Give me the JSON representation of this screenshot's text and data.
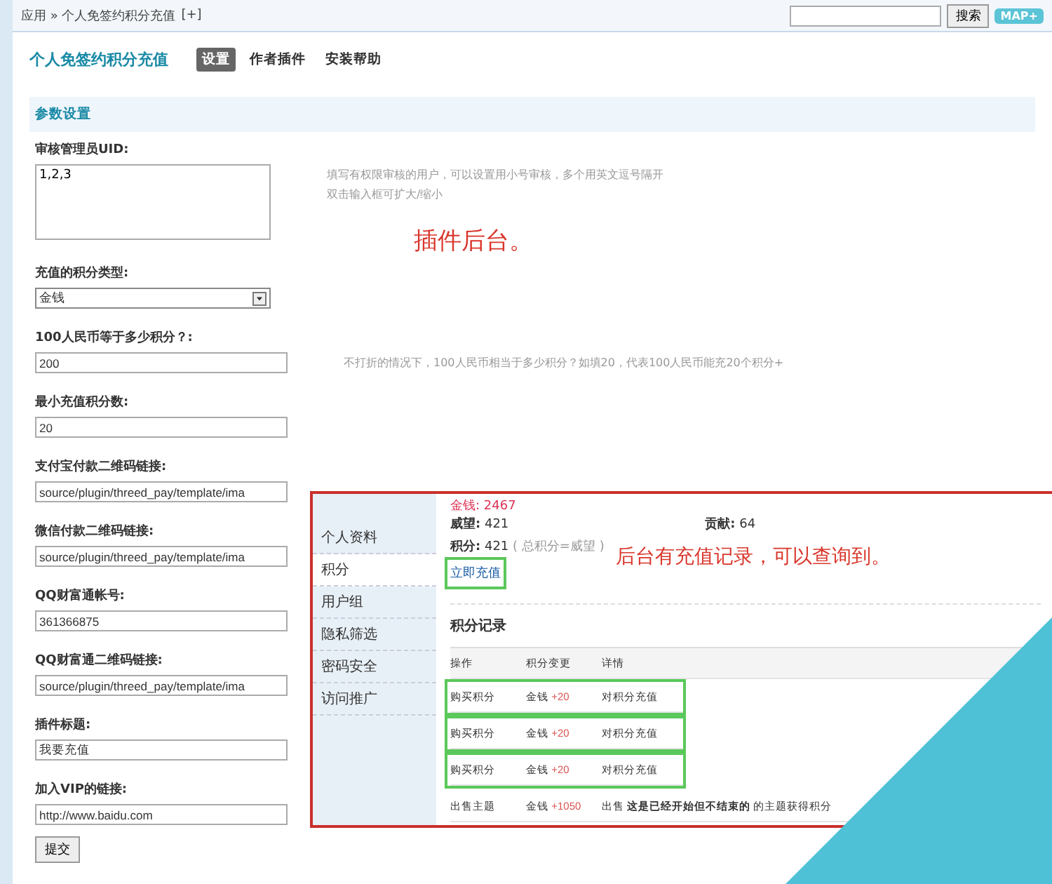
{
  "top_bar": {
    "breadcrumb": "应用 » 个人免签约积分充值",
    "add_link": "[+]",
    "search_button": "搜索",
    "map_button": "MAP+"
  },
  "header": {
    "title": "个人免签约积分充值",
    "tabs": [
      {
        "label": "设置",
        "selected": true
      },
      {
        "label": "作者插件",
        "selected": false
      },
      {
        "label": "安装帮助",
        "selected": false
      }
    ]
  },
  "section_title": "参数设置",
  "fields": [
    {
      "label": "审核管理员UID:",
      "kind": "textarea",
      "value": "1,2,3",
      "hint": [
        "填写有权限审核的用户，可以设置用小号审核，多个用英文逗号隔开",
        "双击输入框可扩大/缩小"
      ]
    },
    {
      "label": "充值的积分类型:",
      "kind": "select",
      "value": "金钱"
    },
    {
      "label": "100人民币等于多少积分？:",
      "kind": "text",
      "value": "200",
      "hint": [
        "不打折的情况下，100人民币相当于多少积分？如填20，代表100人民币能充20个积分+"
      ]
    },
    {
      "label": "最小充值积分数:",
      "kind": "text",
      "value": "20"
    },
    {
      "label": "支付宝付款二维码链接:",
      "kind": "text",
      "value": "source/plugin/threed_pay/template/ima"
    },
    {
      "label": "微信付款二维码链接:",
      "kind": "text",
      "value": "source/plugin/threed_pay/template/ima"
    },
    {
      "label": "QQ财富通帐号:",
      "kind": "text",
      "value": "361366875"
    },
    {
      "label": "QQ财富通二维码链接:",
      "kind": "text",
      "value": "source/plugin/threed_pay/template/ima"
    },
    {
      "label": "插件标题:",
      "kind": "text",
      "value": "我要充值"
    },
    {
      "label": "加入VIP的链接:",
      "kind": "text",
      "value": "http://www.baidu.com"
    }
  ],
  "submit_button": "提交",
  "annotation_plugin": "插件后台。",
  "inset": {
    "sidebar": [
      {
        "label": "个人资料",
        "selected": false
      },
      {
        "label": "积分",
        "selected": true
      },
      {
        "label": "用户组",
        "selected": false
      },
      {
        "label": "隐私筛选",
        "selected": false
      },
      {
        "label": "密码安全",
        "selected": false
      },
      {
        "label": "访问推广",
        "selected": false
      }
    ],
    "money": "金钱: 2467",
    "stats": [
      {
        "label": "威望:",
        "value": "421"
      },
      {
        "label": "贡献:",
        "value": "64"
      }
    ],
    "points_label": "积分:",
    "points_value": "421",
    "points_note": "( 总积分=威望 )",
    "recharge_link": "立即充值",
    "annotation": "后台有充值记录，可以查询到。",
    "records_title": "积分记录",
    "columns": [
      "操作",
      "积分变更",
      "详情"
    ],
    "rows": [
      {
        "action": "购买积分",
        "currency": "金钱",
        "change": "+20",
        "detail": "对积分充值",
        "highlighted": true
      },
      {
        "action": "购买积分",
        "currency": "金钱",
        "change": "+20",
        "detail": "对积分充值",
        "highlighted": true
      },
      {
        "action": "购买积分",
        "currency": "金钱",
        "change": "+20",
        "detail": "对积分充值",
        "highlighted": true
      },
      {
        "action": "出售主题",
        "currency": "金钱",
        "change": "+1050",
        "detail": "出售 **这是已经开始但不结束的** 的主题获得积分",
        "highlighted": false
      }
    ]
  }
}
